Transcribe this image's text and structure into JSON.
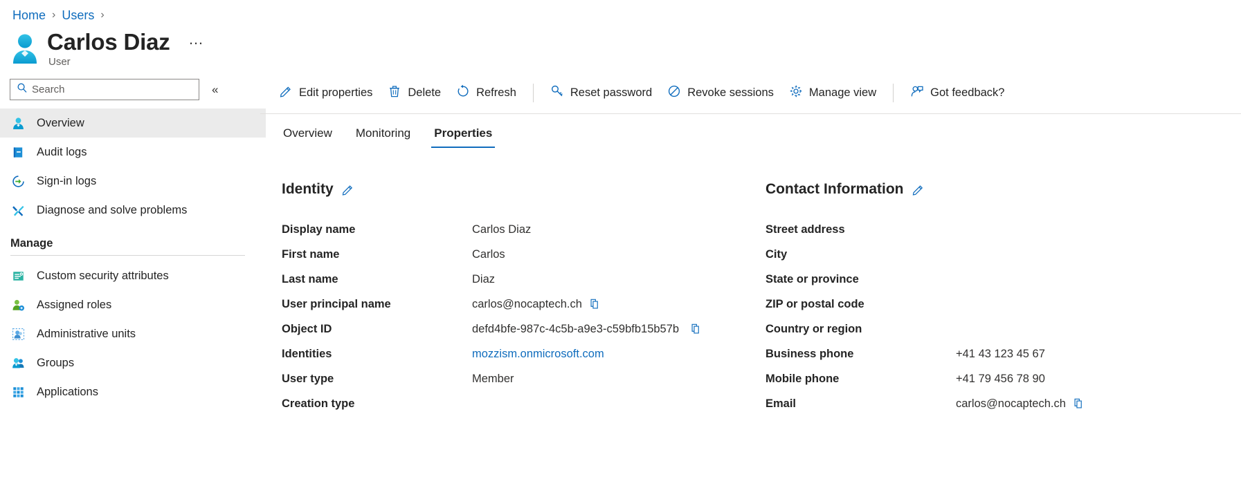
{
  "breadcrumb": {
    "items": [
      {
        "label": "Home"
      },
      {
        "label": "Users"
      }
    ],
    "separator": "›"
  },
  "header": {
    "title": "Carlos Diaz",
    "subtitle": "User",
    "avatar_icon": "user-avatar-icon",
    "more_label": "…"
  },
  "sidebar": {
    "search": {
      "placeholder": "Search",
      "value": "",
      "icon": "search-icon"
    },
    "collapse": {
      "label": "«",
      "icon": "chevron-double-left-icon"
    },
    "items": [
      {
        "label": "Overview",
        "icon": "user-icon",
        "selected": true
      },
      {
        "label": "Audit logs",
        "icon": "book-icon",
        "selected": false
      },
      {
        "label": "Sign-in logs",
        "icon": "sign-in-icon",
        "selected": false
      },
      {
        "label": "Diagnose and solve problems",
        "icon": "wrench-screwdriver-icon",
        "selected": false
      }
    ],
    "group_title": "Manage",
    "manage_items": [
      {
        "label": "Custom security attributes",
        "icon": "attribute-list-icon"
      },
      {
        "label": "Assigned roles",
        "icon": "assigned-roles-icon"
      },
      {
        "label": "Administrative units",
        "icon": "administrative-units-icon"
      },
      {
        "label": "Groups",
        "icon": "groups-icon"
      },
      {
        "label": "Applications",
        "icon": "applications-grid-icon"
      }
    ]
  },
  "toolbar": {
    "buttons": [
      {
        "label": "Edit properties",
        "icon": "pencil-icon"
      },
      {
        "label": "Delete",
        "icon": "trash-icon"
      },
      {
        "label": "Refresh",
        "icon": "refresh-icon"
      },
      {
        "label": "Reset password",
        "icon": "key-icon"
      },
      {
        "label": "Revoke sessions",
        "icon": "block-icon"
      },
      {
        "label": "Manage view",
        "icon": "gear-icon"
      },
      {
        "label": "Got feedback?",
        "icon": "feedback-icon"
      }
    ]
  },
  "tabs": [
    {
      "label": "Overview",
      "active": false
    },
    {
      "label": "Monitoring",
      "active": false
    },
    {
      "label": "Properties",
      "active": true
    }
  ],
  "identity": {
    "title": "Identity",
    "edit_icon": "pencil-edit-icon",
    "rows": [
      {
        "label": "Display name",
        "value": "Carlos Diaz",
        "copy": false,
        "link": false
      },
      {
        "label": "First name",
        "value": "Carlos",
        "copy": false,
        "link": false
      },
      {
        "label": "Last name",
        "value": "Diaz",
        "copy": false,
        "link": false
      },
      {
        "label": "User principal name",
        "value": "carlos@nocaptech.ch",
        "copy": true,
        "link": false
      },
      {
        "label": "Object ID",
        "value": "defd4bfe-987c-4c5b-a9e3-c59bfb15b57b",
        "copy": true,
        "link": false
      },
      {
        "label": "Identities",
        "value": "mozzism.onmicrosoft.com",
        "copy": false,
        "link": true
      },
      {
        "label": "User type",
        "value": "Member",
        "copy": false,
        "link": false
      },
      {
        "label": "Creation type",
        "value": "",
        "copy": false,
        "link": false
      }
    ]
  },
  "contact": {
    "title": "Contact Information",
    "edit_icon": "pencil-edit-icon",
    "rows": [
      {
        "label": "Street address",
        "value": "",
        "copy": false,
        "link": false
      },
      {
        "label": "City",
        "value": "",
        "copy": false,
        "link": false
      },
      {
        "label": "State or province",
        "value": "",
        "copy": false,
        "link": false
      },
      {
        "label": "ZIP or postal code",
        "value": "",
        "copy": false,
        "link": false
      },
      {
        "label": "Country or region",
        "value": "",
        "copy": false,
        "link": false
      },
      {
        "label": "Business phone",
        "value": "+41 43 123 45 67",
        "copy": false,
        "link": false
      },
      {
        "label": "Mobile phone",
        "value": "+41 79 456 78 90",
        "copy": false,
        "link": false
      },
      {
        "label": "Email",
        "value": "carlos@nocaptech.ch",
        "copy": true,
        "link": false
      }
    ]
  },
  "colors": {
    "accent": "#0f6cbd",
    "link": "#0f6cbd",
    "selected_bg": "#ebebeb",
    "text": "#242424",
    "muted": "#605e5c"
  }
}
